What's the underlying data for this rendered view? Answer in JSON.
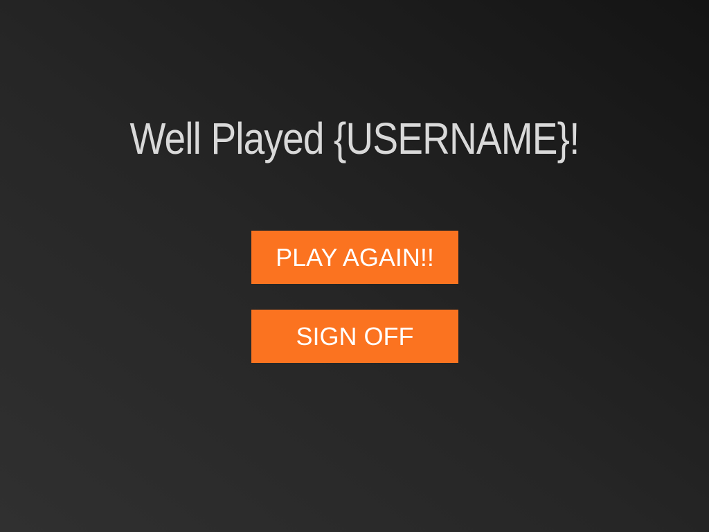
{
  "title": "Well Played {USERNAME}!",
  "buttons": {
    "play_again": "PLAY AGAIN!!",
    "sign_off": "SIGN OFF"
  },
  "colors": {
    "button_bg": "#fb7320",
    "title_text": "#d9d9d9",
    "background_dark": "#141414",
    "background_light": "#303030"
  }
}
